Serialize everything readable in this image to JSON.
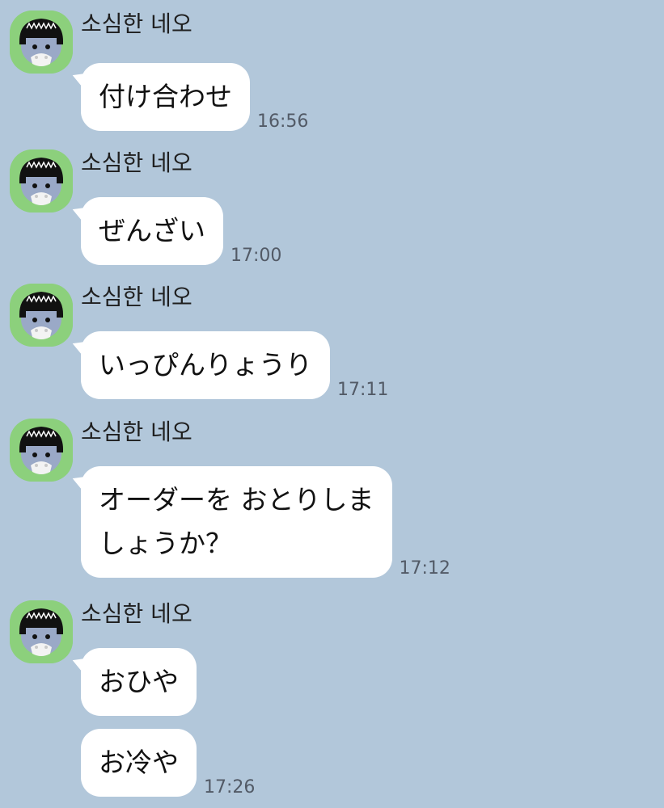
{
  "theme": {
    "background": "#b2c7da",
    "bubble": "#ffffff",
    "avatar_bg": "#8cd07c",
    "text": "#111111",
    "time_text": "#525a66"
  },
  "messages": [
    {
      "sender": "소심한 네오",
      "avatar_icon": "neo-avatar-icon",
      "bubbles": [
        "付け合わせ"
      ],
      "time": "16:56"
    },
    {
      "sender": "소심한 네오",
      "avatar_icon": "neo-avatar-icon",
      "bubbles": [
        "ぜんざい"
      ],
      "time": "17:00"
    },
    {
      "sender": "소심한 네오",
      "avatar_icon": "neo-avatar-icon",
      "bubbles": [
        "いっぴんりょうり"
      ],
      "time": "17:11"
    },
    {
      "sender": "소심한 네오",
      "avatar_icon": "neo-avatar-icon",
      "bubbles": [
        "オーダーを おとりしま",
        "しょうか？"
      ],
      "time": "17:12"
    },
    {
      "sender": "소심한 네오",
      "avatar_icon": "neo-avatar-icon",
      "bubbles": [
        "おひや",
        "お冷や"
      ],
      "time": "17:26"
    }
  ]
}
